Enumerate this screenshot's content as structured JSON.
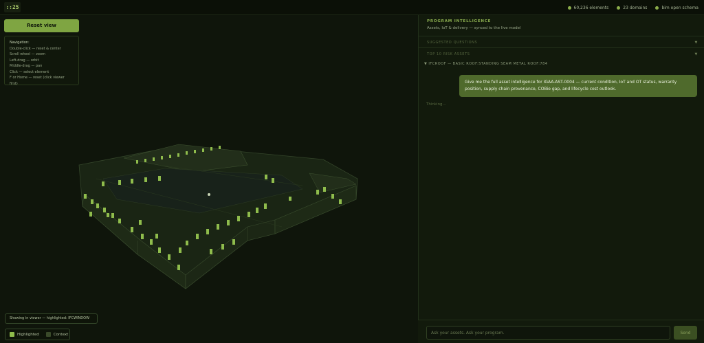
{
  "logo": {
    "text": "::25"
  },
  "stats": [
    {
      "label": "60,236 elements"
    },
    {
      "label": "23 domains"
    },
    {
      "label": "bim open schema"
    }
  ],
  "viewer": {
    "reset_label": "Reset view",
    "navigation": {
      "title": "Navigation:",
      "lines": [
        "Double-click — reset & center",
        "Scroll wheel — zoom",
        "Left-drag — orbit",
        "Middle-drag — pan",
        "Click — select element",
        "F or Home — reset (click viewer first)"
      ]
    },
    "showing": "Showing in viewer — highlighted: IFCWINDOW",
    "legend": [
      {
        "label": "Highlighted",
        "color": "#8fbc4c"
      },
      {
        "label": "Context",
        "color": "#3a4a2a"
      }
    ]
  },
  "panel": {
    "title": "PROGRAM INTELLIGENCE",
    "subtitle": "Assets, IoT & delivery — synced to the live model",
    "accordions": [
      {
        "label": "SUGGESTED QUESTIONS"
      },
      {
        "label": "TOP 10 RISK ASSETS"
      }
    ],
    "section_label": "▼ IFCROOF — BASIC ROOF:STANDING SEAM METAL ROOF:784",
    "user_message": "Give me the full asset intelligence for IGAA-AST-0004 — current condition, IoT and OT status, warranty position, supply chain provenance, COBie gap, and lifecycle cost outlook.",
    "thinking": "Thinking...",
    "input_placeholder": "Ask your assets. Ask your program.",
    "send_label": "Send"
  },
  "colors": {
    "accent": "#7fa542",
    "highlight": "#8fbc4c",
    "bubble": "#4f6a2c"
  }
}
